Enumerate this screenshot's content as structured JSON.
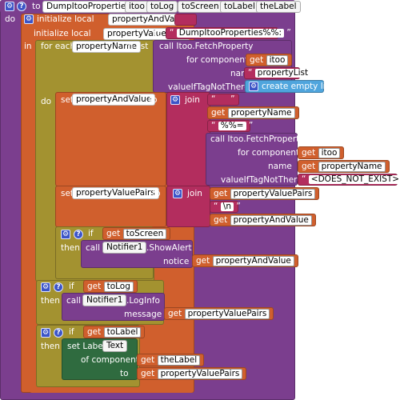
{
  "procedure": {
    "to": "to",
    "name": "DumpItooProperties",
    "params": [
      "itoo",
      "toLog",
      "toScreen",
      "toLabel",
      "theLabel"
    ],
    "do": "do"
  },
  "init1": {
    "label": "initialize local",
    "var": "propertyAndValue",
    "to": "to",
    "value": ""
  },
  "init2": {
    "label": "initialize local",
    "var": "propertyValuePairs",
    "to": "to",
    "value": "DumpItooProperties%%:"
  },
  "foreach": {
    "label": "for each",
    "var": "propertyName",
    "in_list": "in list",
    "in": "in",
    "do": "do"
  },
  "fetch1": {
    "call": "call Itoo.FetchProperty",
    "component_label": "for component",
    "component_get": "get",
    "component_var": "itoo",
    "name_label": "name",
    "name_value": "propertyList",
    "if_label": "valueIfTagNotThere",
    "if_value": "create empty list"
  },
  "set1": {
    "set": "set",
    "var": "propertyAndValue",
    "to": "to",
    "join": "join",
    "s1": "",
    "get": "get",
    "v1": "propertyName",
    "s2": "%%=",
    "call": "call Itoo.FetchProperty",
    "component_label": "for component",
    "component_get": "get",
    "component_var": "itoo",
    "name_label": "name",
    "name_get": "get",
    "name_var": "propertyName",
    "if_label": "valueIfTagNotThere",
    "if_value": "<DOES_NOT_EXIST>"
  },
  "set2": {
    "set": "set",
    "var": "propertyValuePairs",
    "to": "to",
    "join": "join",
    "get": "get",
    "v1": "propertyValuePairs",
    "s1": "\\n",
    "v2": "propertyAndValue"
  },
  "if1": {
    "if": "if",
    "get": "get",
    "var": "toScreen",
    "then": "then",
    "call": "call",
    "component": "Notifier1",
    "method": ".ShowAlert",
    "notice": "notice",
    "arg_var": "propertyAndValue"
  },
  "if2": {
    "if": "if",
    "get": "get",
    "var": "toLog",
    "then": "then",
    "call": "call",
    "component": "Notifier1",
    "method": ".LogInfo",
    "message": "message",
    "arg_var": "propertyValuePairs"
  },
  "if3": {
    "if": "if",
    "get": "get",
    "var": "toLabel",
    "then": "then",
    "set": "set Label.",
    "prop": "Text",
    "component_label": "of component",
    "comp_var": "theLabel",
    "to": "to",
    "to_var": "propertyValuePairs"
  }
}
